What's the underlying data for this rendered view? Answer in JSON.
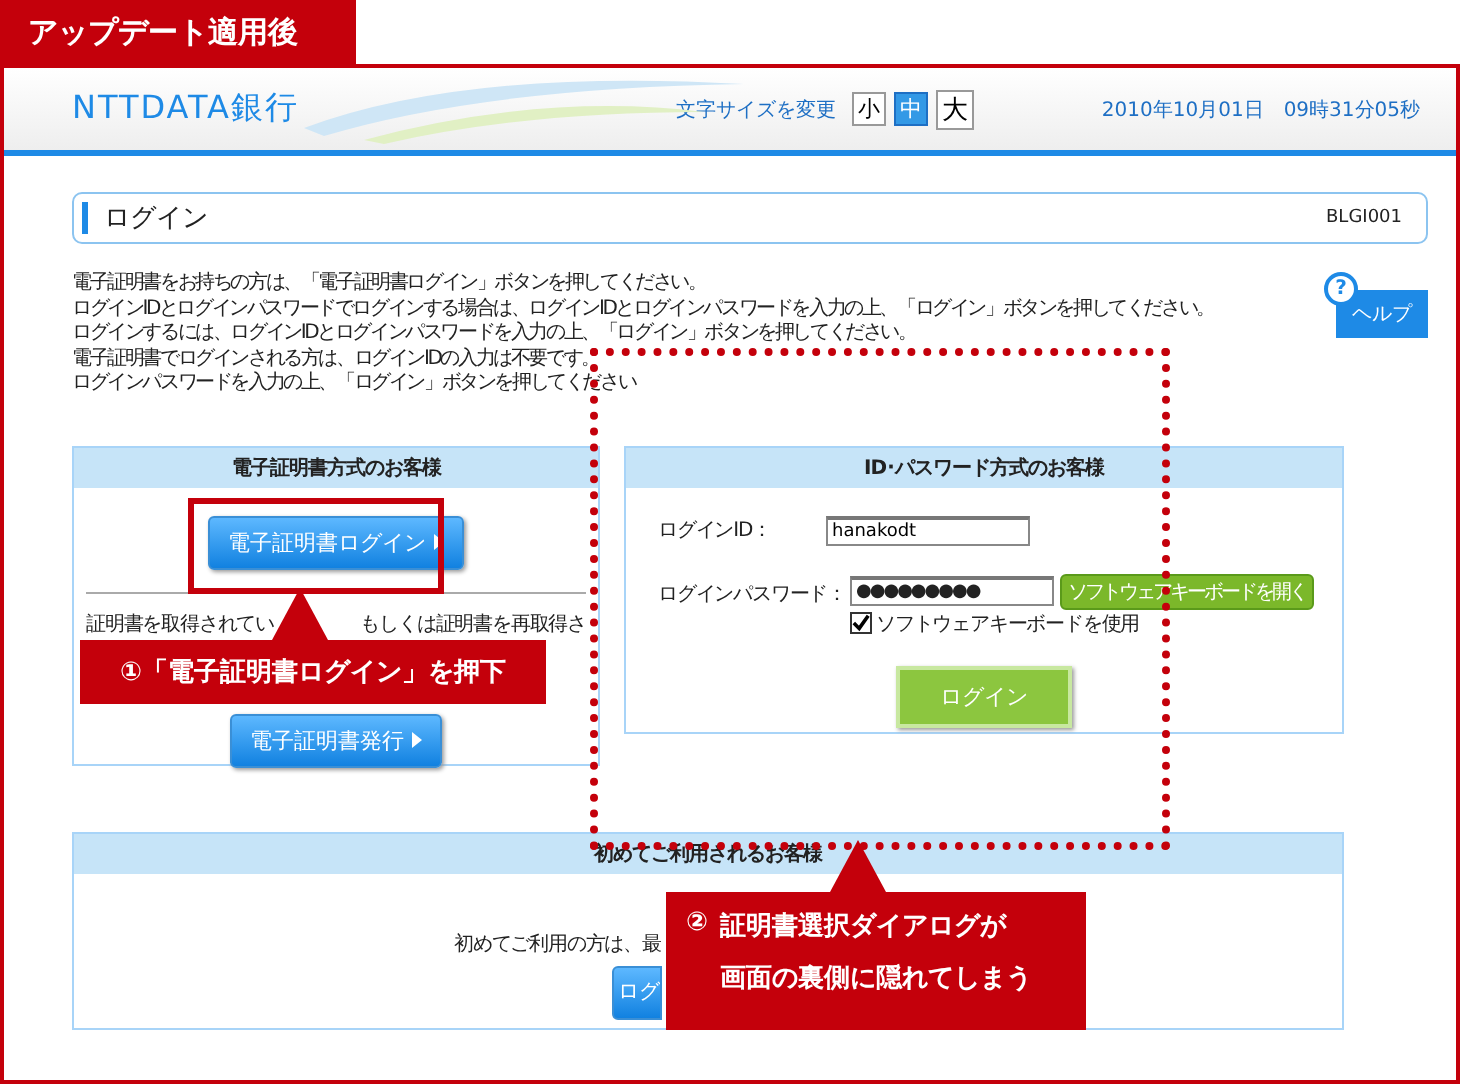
{
  "annotation_tab": "アップデート適用後",
  "header": {
    "logo": "NTTDATA銀行",
    "font_size_label": "文字サイズを変更",
    "font_sizes": [
      {
        "label": "小",
        "selected": false
      },
      {
        "label": "中",
        "selected": true
      },
      {
        "label": "大",
        "selected": false
      }
    ],
    "datetime": "2010年10月01日　09時31分05秒"
  },
  "page_title": {
    "title": "ログイン",
    "code": "BLGI001"
  },
  "instructions": [
    "電子証明書をお持ちの方は、「電子証明書ログイン」ボタンを押してください。",
    "ログインIDとログインパスワードでログインする場合は、ログインIDとログインパスワードを入力の上、「ログイン」ボタンを押してください。",
    "ログインするには、ログインIDとログインパスワードを入力の上、「ログイン」ボタンを押してください。",
    "電子証明書でログインされる方は、ログインIDの入力は不要です。",
    "ログインパスワードを入力の上、「ログイン」ボタンを押してください"
  ],
  "help": {
    "icon": "?",
    "label": "ヘルプ"
  },
  "cert_panel": {
    "heading": "電子証明書方式のお客様",
    "login_button": "電子証明書ログイン",
    "note_parts": [
      "証明書を取得されてい",
      "もしくは証明書を再取得さ"
    ],
    "issue_button": "電子証明書発行"
  },
  "id_panel": {
    "heading": "ID･パスワード方式のお客様",
    "id_label": "ログインID：",
    "id_value": "hanakodt",
    "password_label": "ログインパスワード：",
    "password_value": "●●●●●●●●●",
    "keyboard_button": "ソフトウェアキーボードを開く",
    "keyboard_checkbox": {
      "label": "ソフトウェアキーボードを使用",
      "checked": true
    },
    "login_button": "ログイン"
  },
  "first_panel": {
    "heading": "初めてご利用されるお客様",
    "text": "初めてご利用の方は、最",
    "button": "ログ"
  },
  "callouts": [
    {
      "number": "①",
      "text": "「電子証明書ログイン」を押下"
    },
    {
      "number": "②",
      "lines": [
        "証明書選択ダイアログが",
        "画面の裏側に隠れてしまう"
      ]
    }
  ]
}
